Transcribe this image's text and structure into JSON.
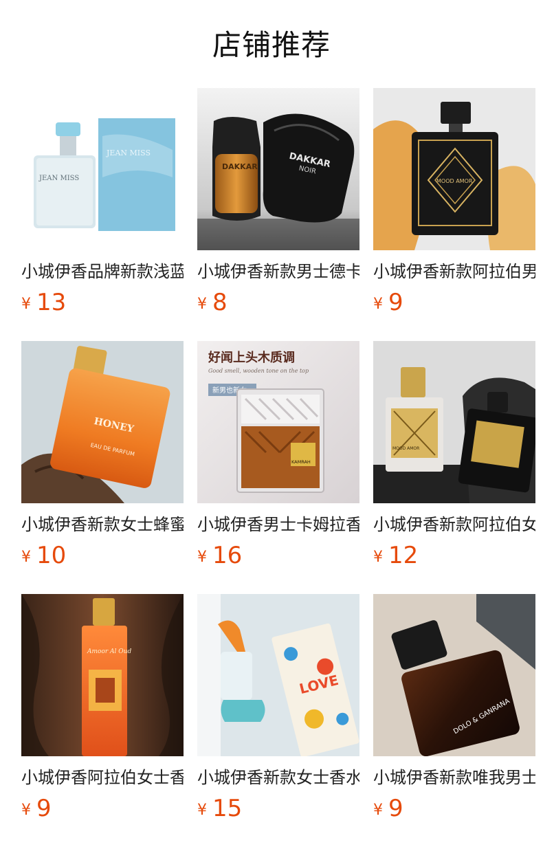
{
  "header": {
    "title": "店铺推荐"
  },
  "products": [
    {
      "name": "小城伊香品牌新款浅蓝男士香水",
      "currency": "¥",
      "price": "13",
      "image_icon": "blue-perfume-bottle-with-box"
    },
    {
      "name": "小城伊香新款男士德卡尔香水",
      "currency": "¥",
      "price": "8",
      "image_icon": "dakkar-noir-perfume-bottles"
    },
    {
      "name": "小城伊香新款阿拉伯男士香水",
      "currency": "¥",
      "price": "9",
      "image_icon": "black-gold-arabic-perfume"
    },
    {
      "name": "小城伊香新款女士蜂蜜香水",
      "currency": "¥",
      "price": "10",
      "image_icon": "honey-orange-perfume"
    },
    {
      "name": "小城伊香男士卡姆拉香水",
      "currency": "¥",
      "price": "16",
      "image_icon": "kamrah-crystal-perfume"
    },
    {
      "name": "小城伊香新款阿拉伯女士香水",
      "currency": "¥",
      "price": "12",
      "image_icon": "white-black-gold-perfume-pair"
    },
    {
      "name": "小城伊香阿拉伯女士香水",
      "currency": "¥",
      "price": "9",
      "image_icon": "amber-arabic-perfume"
    },
    {
      "name": "小城伊香新款女士香水",
      "currency": "¥",
      "price": "15",
      "image_icon": "love-blue-perfume-with-box"
    },
    {
      "name": "小城伊香新款唯我男士香水",
      "currency": "¥",
      "price": "9",
      "image_icon": "dolo-ganrana-dark-perfume"
    }
  ],
  "image_text": {
    "p1_box": "JEAN MISS",
    "p1_bottle": "JEAN MISS",
    "p2_bottle": "DAKKAR",
    "p2_sub": "NOIR",
    "p3_label": "MOOD AMOR",
    "p4_label": "HONEY",
    "p4_sub": "EAU DE PARFUM",
    "p5_headline": "好闻上头木质调",
    "p5_tagline": "Good smell, wooden tone on the top",
    "p5_tag": "新男也新女",
    "p5_label": "KAMRAH",
    "p7_label": "Amoor Al Oud",
    "p8_label": "LOVE",
    "p9_label": "DOLO & GANRANA"
  }
}
